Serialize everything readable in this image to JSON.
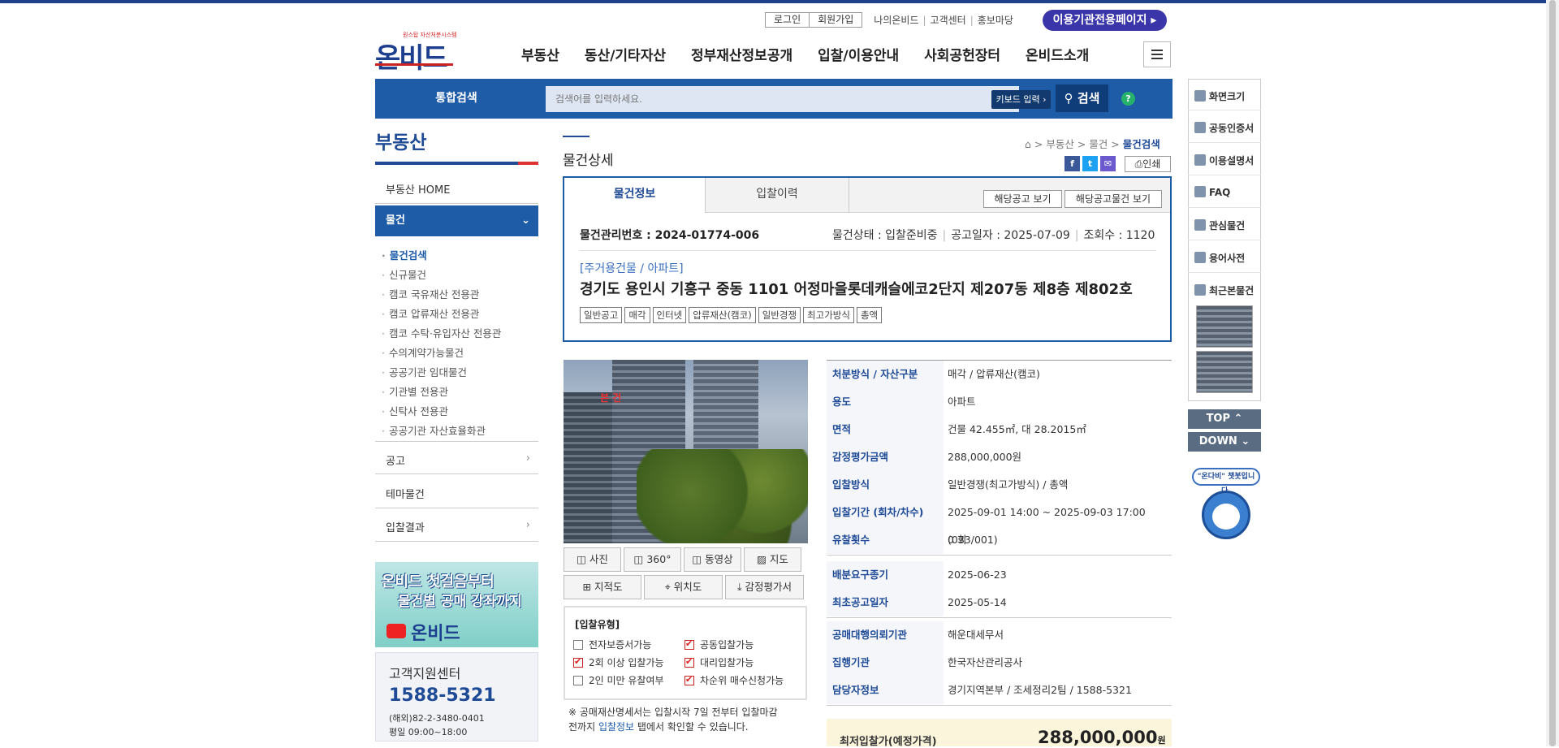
{
  "header": {
    "logo_tagline": "원스탑 자산처분시스템",
    "logo": "온비드",
    "login": "로그인",
    "signup": "회원가입",
    "my_onbid": "나의온비드",
    "customer_center": "고객센터",
    "promo": "홍보마당",
    "agency_page": "이용기관전용페이지",
    "gnb": [
      "부동산",
      "동산/기타자산",
      "정부재산정보공개",
      "입찰/이용안내",
      "사회공헌장터",
      "온비드소개"
    ]
  },
  "search": {
    "label": "통합검색",
    "placeholder": "검색어를 입력하세요.",
    "keyboard": "키보드 입력",
    "button": "검색",
    "help": "?"
  },
  "lnb": {
    "title": "부동산",
    "home": "부동산 HOME",
    "active": "물건",
    "sub": [
      "물건검색",
      "신규물건",
      "캠코 국유재산 전용관",
      "캠코 압류재산 전용관",
      "캠코 수탁·유입자산 전용관",
      "수의계약가능물건",
      "공공기관 임대물건",
      "기관별 전용관",
      "신탁사 전용관",
      "공공기관 자산효율화관"
    ],
    "items": [
      "공고",
      "테마물건",
      "입찰결과"
    ]
  },
  "banner": {
    "line1": "온비드 첫걸음부터",
    "line2": "물건별 공매 강좌까지",
    "brand": "온비드"
  },
  "cs": {
    "title": "고객지원센터",
    "phone": "1588-5321",
    "overseas": "(해외)82-2-3480-0401",
    "hours": "평일 09:00~18:00"
  },
  "main": {
    "title": "물건상세",
    "breadcrumb": [
      "부동산",
      "물건",
      "물건검색"
    ],
    "print": "인쇄",
    "tabs": [
      "물건정보",
      "입찰이력"
    ],
    "btn_notice": "해당공고 보기",
    "btn_notice_items": "해당공고물건 보기",
    "mgmt_no": "물건관리번호 : 2024-01774-006",
    "status": "물건상태 : 입찰준비중",
    "notice_date": "공고일자 : 2025-07-09",
    "views": "조회수 : 1120",
    "category": "[주거용건물 / 아파트]",
    "address": "경기도 용인시 기흥구 중동 1101 어정마을롯데캐슬에코2단지 제207동 제8층 제802호",
    "tags": [
      "일반공고",
      "매각",
      "인터넷",
      "압류재산(캠코)",
      "일반경쟁",
      "최고가방식",
      "총액"
    ]
  },
  "photo": {
    "label": "본 건",
    "buttons1": [
      "사진",
      "360°",
      "동영상",
      "지도"
    ],
    "buttons2": [
      "지적도",
      "위치도",
      "감정평가서"
    ]
  },
  "bid_type": {
    "title": "[입찰유형]",
    "items": [
      {
        "label": "전자보증서가능",
        "checked": false
      },
      {
        "label": "공동입찰가능",
        "checked": true
      },
      {
        "label": "2회 이상 입찰가능",
        "checked": true
      },
      {
        "label": "대리입찰가능",
        "checked": true
      },
      {
        "label": "2인 미만 유찰여부",
        "checked": false
      },
      {
        "label": "차순위 매수신청가능",
        "checked": true
      }
    ],
    "note1": "※ 공매재산명세서는 입찰시작 7일 전부터 입찰마감",
    "note2a": "전까지 ",
    "note2_link": "입찰정보",
    "note2b": " 탭에서 확인할 수 있습니다."
  },
  "info": [
    {
      "k": "처분방식 / 자산구분",
      "v": "매각 / 압류재산(캠코)"
    },
    {
      "k": "용도",
      "v": "아파트"
    },
    {
      "k": "면적",
      "v": "건물 42.455㎡, 대 28.2015㎡"
    },
    {
      "k": "감정평가금액",
      "v": "288,000,000원"
    },
    {
      "k": "입찰방식",
      "v": "일반경쟁(최고가방식) / 총액"
    },
    {
      "k": "입찰기간 (회차/차수)",
      "v": "2025-09-01 14:00 ~ 2025-09-03 17:00 (033/001)"
    },
    {
      "k": "유찰횟수",
      "v": "0 회"
    },
    {
      "k": "배분요구종기",
      "v": "2025-06-23"
    },
    {
      "k": "최초공고일자",
      "v": "2025-05-14"
    },
    {
      "k": "공매대행의뢰기관",
      "v": "해운대세무서"
    },
    {
      "k": "집행기관",
      "v": "한국자산관리공사"
    },
    {
      "k": "담당자정보",
      "v": "경기지역본부 / 조세정리2팀 / 1588-5321"
    }
  ],
  "price": {
    "label": "최저입찰가(예정가격)",
    "value": "288,000,000",
    "unit": "원"
  },
  "quick": {
    "items": [
      "화면크기",
      "공동인증서",
      "이용설명서",
      "FAQ",
      "관심물건",
      "용어사전",
      "최근본물건"
    ],
    "top": "TOP ⌃",
    "down": "DOWN ⌄",
    "bot": "\"온다비\" 챗봇입니다."
  },
  "colors": {
    "brand": "#1e5ca8",
    "accent": "#3a35a8",
    "red": "#d22222"
  }
}
